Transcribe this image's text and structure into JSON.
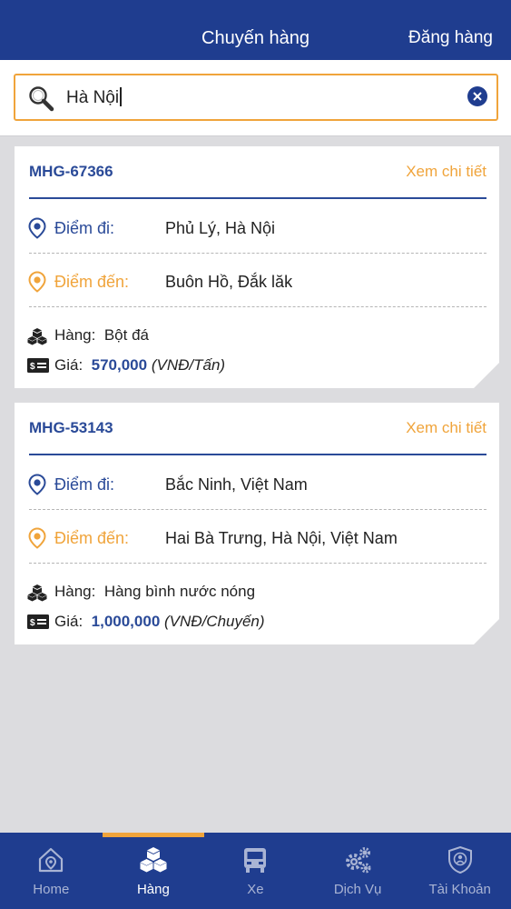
{
  "header": {
    "title": "Chuyến hàng",
    "action": "Đăng hàng"
  },
  "search": {
    "value": "Hà Nội",
    "icon": "search-icon",
    "clear_icon": "clear-icon"
  },
  "colors": {
    "primary": "#1f3d8f",
    "accent": "#f0a43b"
  },
  "shipments": [
    {
      "code": "MHG-67366",
      "detail_label": "Xem chi tiết",
      "from_label": "Điểm đi:",
      "from": "Phủ Lý, Hà Nội",
      "to_label": "Điểm đến:",
      "to": "Buôn Hồ, Đắk lăk",
      "goods_label": "Hàng:",
      "goods": "Bột đá",
      "price_label": "Giá:",
      "price": "570,000",
      "price_unit": "(VNĐ/Tấn)"
    },
    {
      "code": "MHG-53143",
      "detail_label": "Xem chi tiết",
      "from_label": "Điểm đi:",
      "from": "Bắc Ninh, Việt Nam",
      "to_label": "Điểm đến:",
      "to": "Hai Bà Trưng, Hà Nội, Việt Nam",
      "goods_label": "Hàng:",
      "goods": "Hàng bình nước nóng",
      "price_label": "Giá:",
      "price": "1,000,000",
      "price_unit": "(VNĐ/Chuyến)"
    }
  ],
  "tabs": [
    {
      "label": "Home",
      "icon": "home-icon",
      "active": false
    },
    {
      "label": "Hàng",
      "icon": "boxes-icon",
      "active": true
    },
    {
      "label": "Xe",
      "icon": "truck-icon",
      "active": false
    },
    {
      "label": "Dịch Vụ",
      "icon": "gears-icon",
      "active": false
    },
    {
      "label": "Tài Khoản",
      "icon": "account-icon",
      "active": false
    }
  ]
}
